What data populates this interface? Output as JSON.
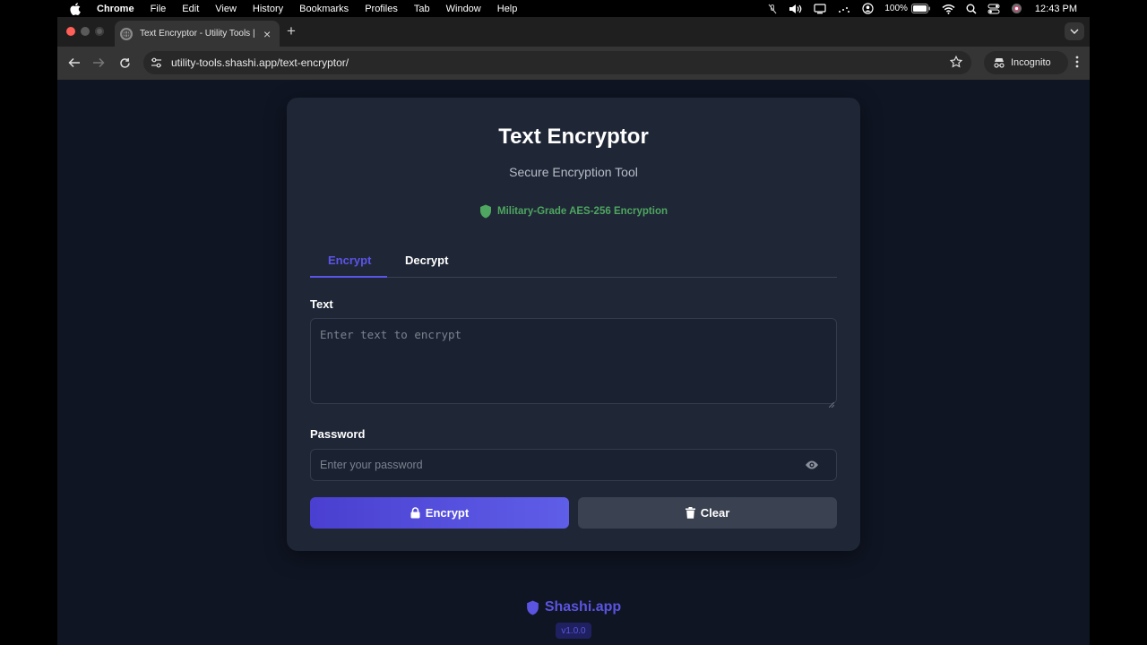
{
  "menubar": {
    "app": "Chrome",
    "items": [
      "File",
      "Edit",
      "View",
      "History",
      "Bookmarks",
      "Profiles",
      "Tab",
      "Window",
      "Help"
    ],
    "battery": "100%",
    "clock": "12:43 PM"
  },
  "browser": {
    "tab_title": "Text Encryptor - Utility Tools | Shashi.app",
    "url": "utility-tools.shashi.app/text-encryptor/",
    "profile_label": "Incognito"
  },
  "app": {
    "title": "Text Encryptor",
    "subtitle": "Secure Encryption Tool",
    "badge": "Military-Grade AES-256 Encryption",
    "tabs": {
      "encrypt": "Encrypt",
      "decrypt": "Decrypt",
      "active": "Encrypt"
    },
    "text_label": "Text",
    "text_placeholder": "Enter text to encrypt",
    "password_label": "Password",
    "password_placeholder": "Enter your password",
    "encrypt_button": "Encrypt",
    "clear_button": "Clear"
  },
  "footer": {
    "brand": "Shashi.app",
    "version": "v1.0.0"
  },
  "colors": {
    "accent": "#5b54e8",
    "badge_green": "#4ea660",
    "page_bg": "#0f1523",
    "card_bg": "#1f2636"
  }
}
